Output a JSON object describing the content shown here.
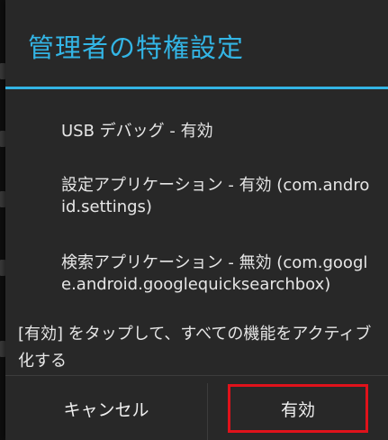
{
  "dialog": {
    "title": "管理者の特権設定",
    "permissions": [
      "USB デバッグ - 有効",
      "設定アプリケーション - 有効 (com.android.settings)",
      "検索アプリケーション - 無効 (com.google.android.googlequicksearchbox)"
    ],
    "message": "[有効] をタップして、すべての機能をアクティブ化する"
  },
  "buttons": {
    "cancel": "キャンセル",
    "activate": "有効"
  },
  "colors": {
    "accent": "#33b5e5",
    "dialog_bg": "#282828",
    "highlight": "#e0121b"
  }
}
